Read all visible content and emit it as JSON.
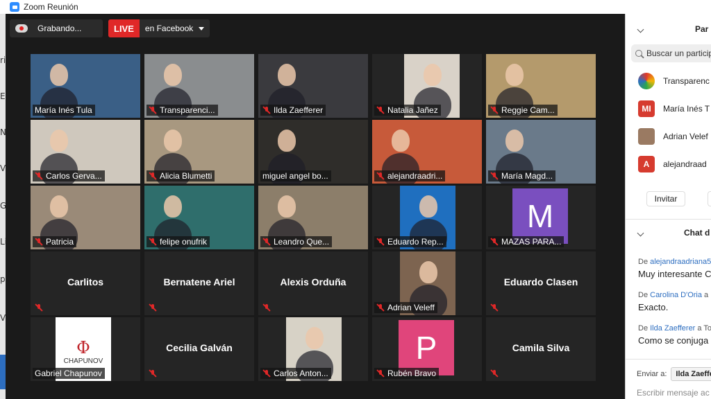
{
  "window": {
    "title": "Zoom Reunión"
  },
  "toolbar": {
    "recording_label": "Grabando...",
    "live_badge": "LIVE",
    "live_target": "en Facebook"
  },
  "left_strip": {
    "fragments": [
      "ri",
      "E",
      "N",
      "V",
      "G",
      "Li",
      "p",
      "V"
    ]
  },
  "tiles": [
    {
      "name": "María Inés Tula",
      "muted": false,
      "video": true,
      "active": true,
      "bg": "#3a5f86"
    },
    {
      "name": "Transparenci...",
      "muted": true,
      "video": true,
      "bg": "#8a8d8f"
    },
    {
      "name": "Ilda Zaefferer",
      "muted": true,
      "video": true,
      "bg": "#3a3a3e"
    },
    {
      "name": "Natalia Jañez",
      "muted": true,
      "video": true,
      "bg": "#d9d2c8"
    },
    {
      "name": "Reggie Cam...",
      "muted": true,
      "video": true,
      "bg": "#b49a6c"
    },
    {
      "name": "Carlos Gerva...",
      "muted": true,
      "video": true,
      "bg": "#cfc8bd"
    },
    {
      "name": "Alicia Blumetti",
      "muted": true,
      "video": true,
      "bg": "#a89880"
    },
    {
      "name": "miguel angel bo...",
      "muted": false,
      "video": true,
      "bg": "#2f2d2a"
    },
    {
      "name": "alejandraadri...",
      "muted": true,
      "video": true,
      "bg": "#c75a3a"
    },
    {
      "name": "María Magd...",
      "muted": true,
      "video": true,
      "bg": "#6a7a8a"
    },
    {
      "name": "Patricia",
      "muted": true,
      "video": true,
      "bg": "#9a8a78"
    },
    {
      "name": "felipe onufrik",
      "muted": true,
      "video": true,
      "bg": "#2f6e6c"
    },
    {
      "name": "Leandro Que...",
      "muted": true,
      "video": true,
      "bg": "#8c7e6a"
    },
    {
      "name": "Eduardo Rep...",
      "muted": true,
      "video": true,
      "bg": "#1f6fbf"
    },
    {
      "name": "MAZAS PARA...",
      "muted": true,
      "video": false,
      "avatar": "M",
      "avatar_color": "#7a4fbf"
    },
    {
      "name": "Carlitos",
      "muted": true,
      "video": false
    },
    {
      "name": "Bernatene Ariel",
      "muted": true,
      "video": false
    },
    {
      "name": "Alexis Orduña",
      "muted": true,
      "video": false
    },
    {
      "name": "Adrian Veleff",
      "muted": true,
      "video": true,
      "bg": "#7d6450"
    },
    {
      "name": "Eduardo Clasen",
      "muted": true,
      "video": false
    },
    {
      "name": "Gabriel Chapunov",
      "muted": false,
      "video": true,
      "bg": "#ffffff",
      "logo_text": "CHAPUNOV",
      "logo_symbol": "Φ"
    },
    {
      "name": "Cecilia Galván",
      "muted": true,
      "video": false
    },
    {
      "name": "Carlos Anton...",
      "muted": true,
      "video": true,
      "bg": "#d7d2c6"
    },
    {
      "name": "Rubén Bravo",
      "muted": true,
      "video": false,
      "avatar": "P",
      "avatar_color": "#e0457b"
    },
    {
      "name": "Camila Silva",
      "muted": true,
      "video": false
    }
  ],
  "participants_panel": {
    "title": "Par",
    "search_placeholder": "Buscar un particip",
    "items": [
      {
        "label": "Transparenc",
        "avatar_color": "#e8e8e8",
        "initials": ""
      },
      {
        "label": "María Inés T",
        "avatar_color": "#d63b2f",
        "initials": "MI"
      },
      {
        "label": "Adrian Velef",
        "avatar_color": "#9a7a62",
        "initials": ""
      },
      {
        "label": "alejandraad",
        "avatar_color": "#d63b2f",
        "initials": "A"
      }
    ],
    "invite_label": "Invitar"
  },
  "chat_panel": {
    "title": "Chat d",
    "messages": [
      {
        "from_prefix": "De",
        "from": "alejandraadriana5",
        "to": "",
        "text": "Muy interesante C"
      },
      {
        "from_prefix": "De",
        "from": "Carolina D'Oria",
        "to": "a",
        "text": "Exacto."
      },
      {
        "from_prefix": "De",
        "from": "Ilda Zaefferer",
        "to": "a To",
        "text": "Como se conjuga"
      }
    ],
    "send_to_label": "Enviar a:",
    "send_to_value": "Ilda Zaeffe",
    "composer_placeholder": "Escribir mensaje ac"
  },
  "colors": {
    "accent_active_speaker": "#c8e05a",
    "live_red": "#e02828",
    "mute_red": "#e02828",
    "link_blue": "#2d6ec0"
  }
}
